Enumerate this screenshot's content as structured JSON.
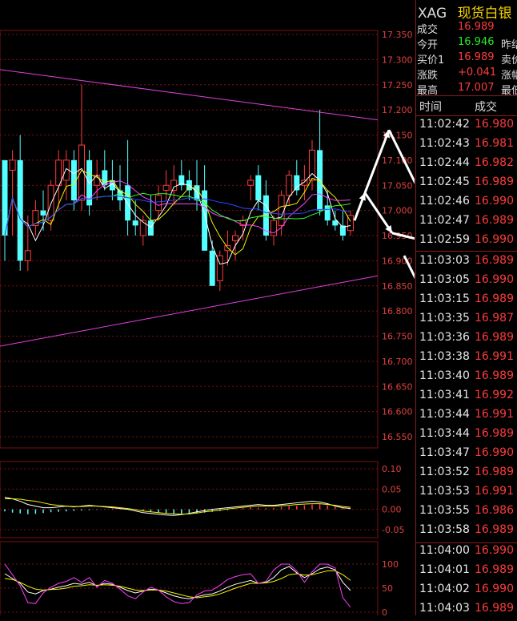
{
  "colors": {
    "up": "#ff3b3b",
    "down": "#54ffff",
    "ma1": "#ffffff",
    "ma2": "#f2f200",
    "ma3": "#ff40ff",
    "ma4": "#33ff33",
    "ma5": "#2a48ff",
    "trend": "#e040e0",
    "grid": "#7a1010",
    "axis": "#e04040",
    "text_light": "#dcdcdc",
    "gold": "#f5d400"
  },
  "header": {
    "code": "XAG",
    "name": "现货白银"
  },
  "quote": [
    {
      "label": "成交",
      "value": "16.989",
      "color": "#ff3b3b",
      "extra": ""
    },
    {
      "label": "今开",
      "value": "16.946",
      "color": "#22ee22",
      "extra": "昨结"
    },
    {
      "label": "买价1",
      "value": "16.989",
      "color": "#ff3b3b",
      "extra": "卖价"
    },
    {
      "label": "涨跌",
      "value": "+0.041",
      "color": "#ff3b3b",
      "extra": "涨幅"
    },
    {
      "label": "最高",
      "value": "17.007",
      "color": "#ff3b3b",
      "extra": "最低"
    }
  ],
  "ticks_header": {
    "time": "时间",
    "price": "成交"
  },
  "ticks": [
    {
      "time": "11:02:42",
      "price": "16.980"
    },
    {
      "time": "11:02:43",
      "price": "16.981"
    },
    {
      "time": "11:02:44",
      "price": "16.982"
    },
    {
      "time": "11:02:45",
      "price": "16.989"
    },
    {
      "time": "11:02:46",
      "price": "16.990"
    },
    {
      "time": "11:02:47",
      "price": "16.989"
    },
    {
      "time": "11:02:59",
      "price": "16.990"
    },
    {
      "time": "11:03:03",
      "price": "16.989"
    },
    {
      "time": "11:03:05",
      "price": "16.990"
    },
    {
      "time": "11:03:15",
      "price": "16.989"
    },
    {
      "time": "11:03:35",
      "price": "16.987"
    },
    {
      "time": "11:03:36",
      "price": "16.989"
    },
    {
      "time": "11:03:38",
      "price": "16.991"
    },
    {
      "time": "11:03:40",
      "price": "16.989"
    },
    {
      "time": "11:03:41",
      "price": "16.992"
    },
    {
      "time": "11:03:44",
      "price": "16.991"
    },
    {
      "time": "11:03:44",
      "price": "16.989"
    },
    {
      "time": "11:03:47",
      "price": "16.990"
    },
    {
      "time": "11:03:52",
      "price": "16.989"
    },
    {
      "time": "11:03:53",
      "price": "16.991"
    },
    {
      "time": "11:03:55",
      "price": "16.986"
    },
    {
      "time": "11:03:58",
      "price": "16.989"
    },
    {
      "time": "11:04:00",
      "price": "16.990"
    },
    {
      "time": "11:04:01",
      "price": "16.989"
    },
    {
      "time": "11:04:02",
      "price": "16.990"
    },
    {
      "time": "11:04:03",
      "price": "16.989"
    }
  ],
  "price_axis": {
    "labels": [
      "17.350",
      "17.300",
      "17.250",
      "17.200",
      "17.150",
      "17.100",
      "17.050",
      "17.000",
      "16.950",
      "16.900",
      "16.850",
      "16.800",
      "16.750",
      "16.700",
      "16.650",
      "16.600",
      "16.550"
    ],
    "min": 16.55,
    "max": 17.35
  },
  "macd_axis": {
    "labels": [
      "0.10",
      "0.05",
      "0.00",
      "-0.05"
    ],
    "min": -0.05,
    "max": 0.1
  },
  "kdj_axis": {
    "labels": [
      "100",
      "50",
      "0"
    ],
    "min": 0,
    "max": 100
  },
  "candles": [
    [
      17.1,
      17.05,
      16.9,
      16.95
    ],
    [
      17.08,
      17.12,
      16.95,
      17.1
    ],
    [
      17.1,
      17.15,
      16.88,
      16.9
    ],
    [
      16.9,
      16.99,
      16.88,
      16.92
    ],
    [
      16.97,
      17.02,
      16.95,
      17.0
    ],
    [
      17.0,
      17.04,
      16.96,
      16.99
    ],
    [
      16.98,
      17.06,
      16.96,
      17.05
    ],
    [
      17.05,
      17.12,
      17.0,
      17.1
    ],
    [
      17.06,
      17.12,
      17.02,
      17.1
    ],
    [
      17.1,
      17.12,
      17.0,
      17.02
    ],
    [
      17.02,
      17.25,
      17.0,
      17.13
    ],
    [
      17.1,
      17.12,
      16.99,
      17.01
    ],
    [
      17.05,
      17.1,
      17.02,
      17.07
    ],
    [
      17.08,
      17.12,
      17.04,
      17.05
    ],
    [
      17.06,
      17.1,
      17.02,
      17.04
    ],
    [
      17.04,
      17.09,
      17.0,
      17.02
    ],
    [
      17.05,
      17.14,
      16.95,
      16.98
    ],
    [
      16.98,
      17.02,
      16.95,
      16.97
    ],
    [
      16.95,
      16.99,
      16.93,
      16.98
    ],
    [
      16.98,
      17.03,
      16.95,
      16.95
    ],
    [
      17.0,
      17.05,
      16.98,
      17.03
    ],
    [
      17.04,
      17.08,
      17.02,
      17.05
    ],
    [
      17.04,
      17.09,
      17.01,
      17.06
    ],
    [
      17.07,
      17.1,
      17.04,
      17.05
    ],
    [
      17.06,
      17.08,
      17.02,
      17.04
    ],
    [
      17.05,
      17.1,
      17.0,
      17.02
    ],
    [
      17.04,
      17.09,
      16.95,
      16.92
    ],
    [
      16.92,
      16.94,
      16.85,
      16.85
    ],
    [
      16.86,
      16.92,
      16.84,
      16.91
    ],
    [
      16.92,
      16.96,
      16.89,
      16.93
    ],
    [
      16.94,
      16.96,
      16.9,
      16.95
    ],
    [
      16.97,
      16.99,
      16.94,
      16.98
    ],
    [
      17.05,
      17.07,
      17.02,
      17.06
    ],
    [
      17.07,
      17.09,
      17.0,
      17.02
    ],
    [
      17.03,
      17.06,
      16.94,
      16.95
    ],
    [
      16.95,
      16.99,
      16.93,
      16.98
    ],
    [
      16.97,
      17.04,
      16.95,
      17.03
    ],
    [
      17.03,
      17.08,
      17.01,
      17.07
    ],
    [
      17.07,
      17.1,
      17.03,
      17.04
    ],
    [
      17.05,
      17.09,
      17.02,
      17.06
    ],
    [
      17.06,
      17.14,
      17.04,
      17.12
    ],
    [
      17.12,
      17.2,
      16.99,
      17.0
    ],
    [
      17.01,
      17.04,
      16.97,
      16.98
    ],
    [
      16.98,
      17.0,
      16.96,
      16.97
    ],
    [
      16.97,
      17.0,
      16.94,
      16.95
    ],
    [
      16.96,
      17.0,
      16.95,
      16.99
    ]
  ],
  "macd_hist": [
    -0.005,
    -0.008,
    -0.01,
    -0.012,
    -0.011,
    -0.009,
    -0.007,
    -0.006,
    -0.005,
    -0.004,
    -0.003,
    -0.002,
    -0.001,
    0.001,
    0.002,
    0.002,
    0.001,
    -0.002,
    -0.004,
    -0.006,
    -0.008,
    -0.01,
    -0.012,
    -0.013,
    -0.012,
    -0.01,
    -0.008,
    -0.006,
    -0.004,
    -0.002,
    0.001,
    0.003,
    0.005,
    0.004,
    0.003,
    0.004,
    0.006,
    0.008,
    0.009,
    0.01,
    0.012,
    0.013,
    0.01,
    0.006,
    0.003,
    0.001
  ],
  "macd_dif": [
    0.03,
    0.026,
    0.02,
    0.012,
    0.008,
    0.004,
    0.004,
    0.006,
    0.008,
    0.006,
    0.008,
    0.01,
    0.008,
    0.006,
    0.004,
    0.002,
    0.0,
    -0.004,
    -0.008,
    -0.01,
    -0.012,
    -0.014,
    -0.015,
    -0.013,
    -0.01,
    -0.006,
    -0.003,
    0.0,
    0.002,
    0.004,
    0.006,
    0.008,
    0.01,
    0.012,
    0.01,
    0.01,
    0.012,
    0.014,
    0.016,
    0.018,
    0.02,
    0.018,
    0.014,
    0.008,
    0.004,
    0.002
  ],
  "macd_dea": [
    0.026,
    0.026,
    0.025,
    0.022,
    0.02,
    0.016,
    0.012,
    0.01,
    0.008,
    0.007,
    0.007,
    0.008,
    0.008,
    0.007,
    0.006,
    0.004,
    0.002,
    -0.001,
    -0.004,
    -0.006,
    -0.008,
    -0.01,
    -0.011,
    -0.012,
    -0.011,
    -0.009,
    -0.006,
    -0.004,
    -0.002,
    0.001,
    0.003,
    0.005,
    0.007,
    0.008,
    0.008,
    0.008,
    0.009,
    0.01,
    0.012,
    0.013,
    0.014,
    0.014,
    0.012,
    0.01,
    0.007,
    0.005
  ],
  "kdj_k": [
    80,
    70,
    60,
    42,
    38,
    45,
    48,
    52,
    55,
    60,
    58,
    62,
    55,
    60,
    58,
    52,
    45,
    40,
    44,
    48,
    46,
    40,
    34,
    30,
    28,
    32,
    36,
    38,
    44,
    52,
    58,
    62,
    66,
    60,
    62,
    72,
    88,
    95,
    82,
    72,
    80,
    90,
    94,
    88,
    62,
    45
  ],
  "kdj_d": [
    70,
    68,
    62,
    54,
    48,
    46,
    47,
    48,
    50,
    54,
    55,
    57,
    56,
    57,
    56,
    54,
    50,
    46,
    45,
    46,
    46,
    44,
    40,
    36,
    32,
    30,
    32,
    34,
    38,
    44,
    50,
    55,
    60,
    60,
    61,
    64,
    70,
    78,
    80,
    77,
    78,
    82,
    86,
    86,
    78,
    66
  ],
  "kdj_j": [
    100,
    78,
    55,
    20,
    18,
    40,
    52,
    60,
    64,
    72,
    62,
    72,
    52,
    66,
    60,
    48,
    34,
    28,
    42,
    52,
    46,
    32,
    22,
    18,
    20,
    36,
    44,
    46,
    56,
    68,
    74,
    78,
    80,
    60,
    64,
    88,
    100,
    100,
    86,
    62,
    84,
    100,
    100,
    92,
    30,
    10
  ]
}
